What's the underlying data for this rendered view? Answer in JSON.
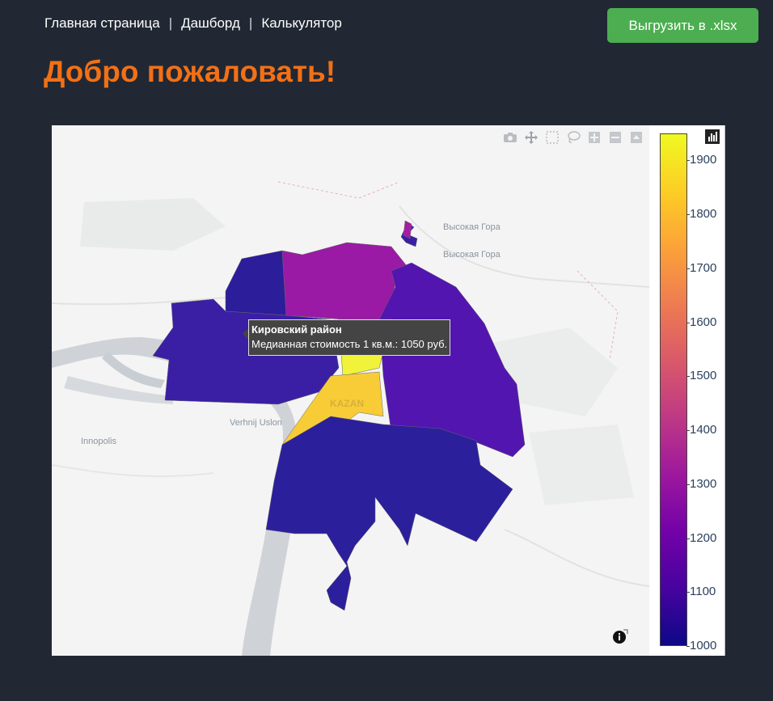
{
  "nav": {
    "home": "Главная страница",
    "sep1": "|",
    "dashboard": "Дашборд",
    "sep2": "|",
    "calculator": "Калькулятор"
  },
  "export_button": "Выгрузить в .xlsx",
  "title": "Добро пожаловать!",
  "map": {
    "place_labels": [
      "Высокая Гора",
      "Высокая Гора",
      "Verhnij Uslon",
      "Innopolis",
      "KAZAN"
    ],
    "tooltip": {
      "title": "Кировский район",
      "text": "Медианная стоимость 1 кв.м.: 1050 руб."
    },
    "modebar_icons": [
      "camera-icon",
      "pan-icon",
      "box-select-icon",
      "lasso-icon",
      "zoom-in-icon",
      "zoom-out-icon",
      "reset-icon"
    ],
    "info_icon": "info-icon",
    "colors": {
      "accent": "#f27016",
      "button": "#4cae50",
      "background": "#212833"
    }
  },
  "colorbar": {
    "colorscale": "Plasma",
    "range": [
      1000,
      1950
    ],
    "ticks": [
      "1900",
      "1800",
      "1700",
      "1600",
      "1500",
      "1400",
      "1300",
      "1200",
      "1100",
      "1000"
    ]
  }
}
